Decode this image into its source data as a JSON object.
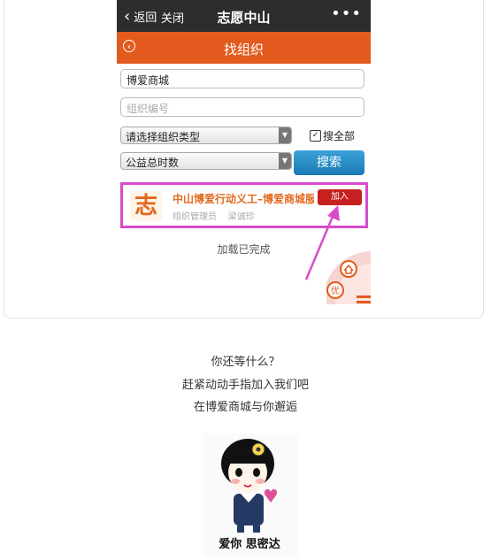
{
  "app": {
    "back_label": "返回",
    "close_label": "关闭",
    "window_title": "志愿中山",
    "more_icon": "ellipsis-icon"
  },
  "page": {
    "title": "找组织"
  },
  "form": {
    "name_value": "博爱商城",
    "number_placeholder": "组织编号",
    "type_select": "请选择组织类型",
    "search_all_label": "搜全部",
    "hours_select": "公益总时数",
    "search_button": "搜索"
  },
  "result": {
    "logo_char": "志",
    "name": "中山博爱行动义工–博爱商城服务",
    "role": "组织管理员",
    "manager": "梁诚珍",
    "join_label": "加入"
  },
  "status": {
    "loaded": "加载已完成"
  },
  "deco": {
    "badge_char": "优"
  },
  "captions": {
    "line1": "你还等什么？",
    "line2": "赶紧动动手指加入我们吧",
    "line3": "在博爱商城与你邂逅"
  },
  "meme": {
    "caption": "爱你 思密达"
  },
  "colors": {
    "header_dark": "#2d2d2d",
    "header_orange": "#e35a1e",
    "highlight": "#d84cc9",
    "join_red": "#c62020",
    "search_blue": "#1a79b3"
  }
}
